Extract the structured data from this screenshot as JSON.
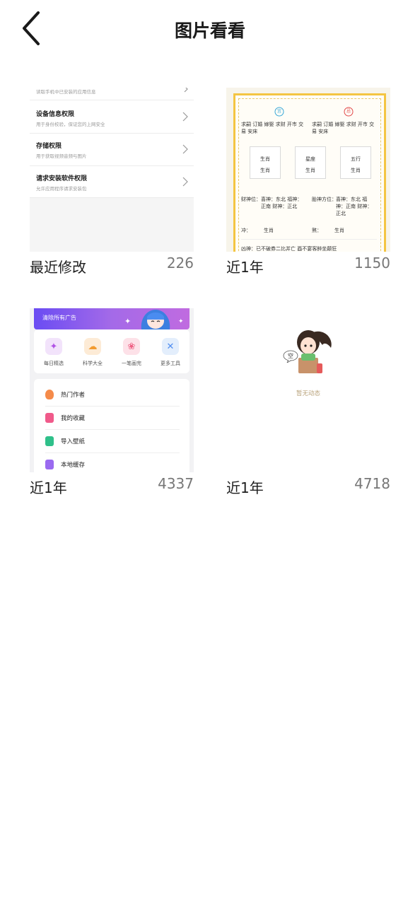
{
  "header": {
    "title": "图片看看"
  },
  "albums": [
    {
      "name": "最近修改",
      "count": "226",
      "thumb": {
        "rows": [
          {
            "title": "",
            "subtitle": "读取手机中已安装的应用信息"
          },
          {
            "title": "设备信息权限",
            "subtitle": "用于身份校验，保证您的上网安全"
          },
          {
            "title": "存储权限",
            "subtitle": "用于获取视频音频与图片"
          },
          {
            "title": "请求安装软件权限",
            "subtitle": "允许应用程序请求安装包"
          }
        ]
      }
    },
    {
      "name": "近1年",
      "count": "1150",
      "thumb": {
        "good_badge": "宜",
        "bad_badge": "忌",
        "good_text": "求嗣 订婚 嫁娶 求财 开市 交易 安床",
        "bad_text": "求嗣 订婚 嫁娶 求财 开市 交易 安床",
        "boxes": [
          {
            "title": "生肖",
            "value": "生肖"
          },
          {
            "title": "星座",
            "value": "生肖"
          },
          {
            "title": "五行",
            "value": "生肖"
          }
        ],
        "wealth_label": "财神位：",
        "wealth_text": "喜神：东北 福神：正南 财神：正北",
        "fetal_label": "胎神方位：",
        "fetal_text": "喜神：东北 福神：正南 财神：正北",
        "chong_label": "冲：",
        "chong_value": "生肖",
        "sha_label": "煞：",
        "sha_value": "生肖",
        "bottom_text": "凶神：已不破券二比并亡 酉不宴客醉坐颠狂"
      }
    },
    {
      "name": "近1年",
      "count": "4337",
      "thumb": {
        "banner_text": "清除所有广告",
        "tools": [
          {
            "label": "每日精选",
            "icon": "sparkle-icon",
            "color": "#f2e3fb",
            "glyph": "✦",
            "glyph_color": "#b153e6"
          },
          {
            "label": "科学大全",
            "icon": "cloud-icon",
            "color": "#fdebd6",
            "glyph": "☁",
            "glyph_color": "#f29a2e"
          },
          {
            "label": "一笔画完",
            "icon": "paw-icon",
            "color": "#fde1e8",
            "glyph": "❀",
            "glyph_color": "#ee5f83"
          },
          {
            "label": "更多工具",
            "icon": "wrench-icon",
            "color": "#e3eefc",
            "glyph": "✕",
            "glyph_color": "#4f8df0"
          }
        ],
        "list": [
          {
            "label": "热门作者",
            "icon": "flame-icon",
            "color": "#f58b4a"
          },
          {
            "label": "我的收藏",
            "icon": "heart-icon",
            "color": "#f05a8a"
          },
          {
            "label": "导入壁纸",
            "icon": "download-icon",
            "color": "#2fc08a"
          },
          {
            "label": "本地缓存",
            "icon": "phone-icon",
            "color": "#9a6af0"
          }
        ]
      }
    },
    {
      "name": "近1年",
      "count": "4718",
      "thumb": {
        "bubble": "空",
        "empty_text": "暂无动态"
      }
    }
  ]
}
